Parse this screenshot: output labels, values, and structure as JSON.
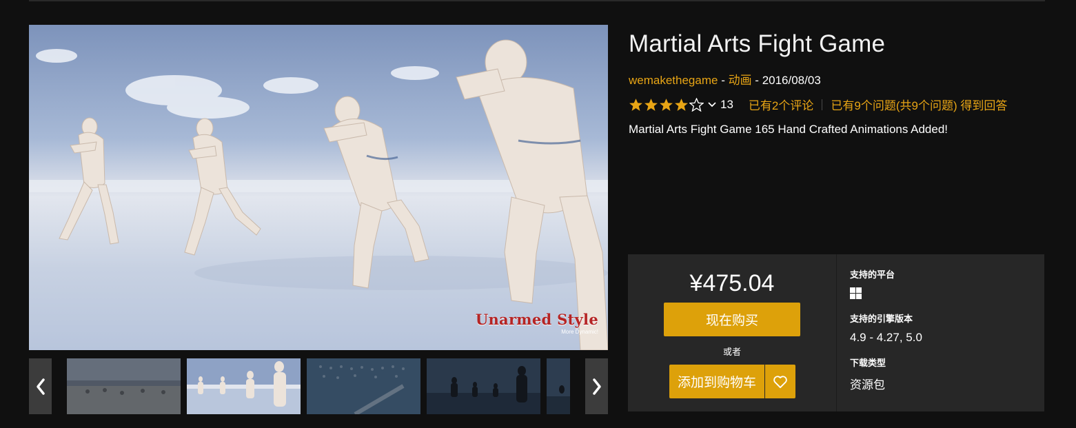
{
  "product": {
    "title": "Martial Arts Fight Game",
    "seller": "wemakethegame",
    "separator1": " - ",
    "category": "动画",
    "separator2": " - ",
    "date": "2016/08/03",
    "rating_stars": 4,
    "rating_count": "13",
    "reviews_link": "已有2个评论",
    "questions_link": "已有9个问题(共9个问题) 得到回答",
    "description": "Martial Arts Fight Game 165 Hand Crafted Animations Added!"
  },
  "media": {
    "watermark_title": "Unarmed Style",
    "watermark_subtitle": "More Dynamic!",
    "selected_thumbnail": 1,
    "thumbnail_count": 5
  },
  "purchase": {
    "price": "¥475.04",
    "buy_now_label": "现在购买",
    "or_label": "或者",
    "add_to_cart_label": "添加到购物车"
  },
  "specs": {
    "platform_label": "支持的平台",
    "platform_icon": "windows-icon",
    "engine_label": "支持的引擎版本",
    "engine_value": "4.9 - 4.27, 5.0",
    "download_label": "下载类型",
    "download_value": "资源包"
  },
  "colors": {
    "accent": "#dda10a",
    "link": "#e8a515",
    "background": "#101010",
    "panel": "#272727",
    "watermark": "#b52424"
  },
  "icons": {
    "prev": "chevron-left-icon",
    "next": "chevron-right-icon",
    "rating_dropdown": "chevron-down-icon",
    "wishlist": "heart-icon"
  }
}
